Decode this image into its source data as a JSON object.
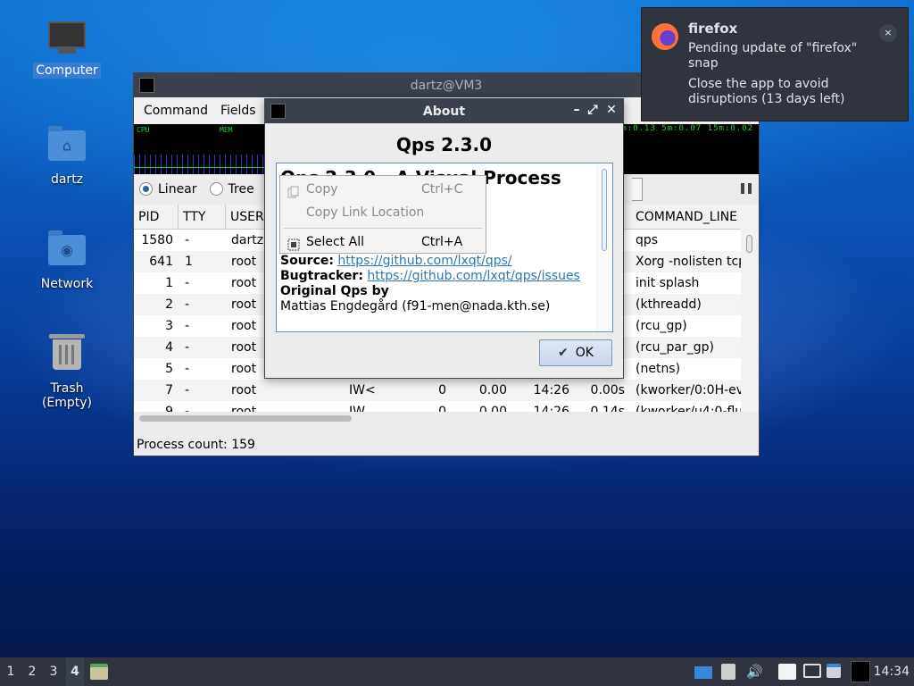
{
  "desktop": {
    "icons": [
      {
        "label": "Computer"
      },
      {
        "label": "dartz"
      },
      {
        "label": "Network"
      },
      {
        "label": "Trash (Empty)"
      }
    ]
  },
  "main_window": {
    "title": "dartz@VM3",
    "menu": [
      "Command",
      "Fields"
    ],
    "graph": {
      "cpu_label": "CPU",
      "mem_label": "MEM",
      "load_text": "1m:0.13 5m:0.07 15m:0.02"
    },
    "view_modes": {
      "linear": "Linear",
      "tree": "Tree",
      "selected": "Linear"
    },
    "columns": {
      "pid": "PID",
      "tty": "TTY",
      "user": "USER",
      "command_line": "COMMAND_LINE"
    },
    "rows": [
      {
        "pid": "1580",
        "tty": "-",
        "user": "dartz",
        "stat": "",
        "nice": "",
        "cpu": "",
        "start": "",
        "time": "",
        "cmd": "qps"
      },
      {
        "pid": "641",
        "tty": "1",
        "user": "root",
        "stat": "",
        "nice": "",
        "cpu": "",
        "start": "",
        "time": "",
        "cmd": "Xorg -nolisten tcp"
      },
      {
        "pid": "1",
        "tty": "-",
        "user": "root",
        "stat": "",
        "nice": "",
        "cpu": "",
        "start": "",
        "time": "",
        "cmd": "init splash"
      },
      {
        "pid": "2",
        "tty": "-",
        "user": "root",
        "stat": "",
        "nice": "",
        "cpu": "",
        "start": "",
        "time": "",
        "cmd": "(kthreadd)"
      },
      {
        "pid": "3",
        "tty": "-",
        "user": "root",
        "stat": "",
        "nice": "",
        "cpu": "",
        "start": "",
        "time": "",
        "cmd": "(rcu_gp)"
      },
      {
        "pid": "4",
        "tty": "-",
        "user": "root",
        "stat": "",
        "nice": "",
        "cpu": "",
        "start": "",
        "time": "",
        "cmd": "(rcu_par_gp)"
      },
      {
        "pid": "5",
        "tty": "-",
        "user": "root",
        "stat": "",
        "nice": "",
        "cpu": "",
        "start": "",
        "time": "",
        "cmd": "(netns)"
      },
      {
        "pid": "7",
        "tty": "-",
        "user": "root",
        "stat": "IW<",
        "nice": "0",
        "cpu": "0.00",
        "start": "14:26",
        "time": "0.00s",
        "cmd": "(kworker/0:0H-ev"
      },
      {
        "pid": "9",
        "tty": "-",
        "user": "root",
        "stat": "IW",
        "nice": "0",
        "cpu": "0.00",
        "start": "14:26",
        "time": "0.14s",
        "cmd": "(kworker/u4:0-flu"
      }
    ],
    "status": "Process count: 159"
  },
  "about_dialog": {
    "title": "About",
    "heading": "Qps 2.3.0",
    "body_heading": "Qps 2.3.0 - A Visual Process",
    "source_label": "Source:",
    "source_url": "https://github.com/lxqt/qps/",
    "bugtracker_label": "Bugtracker:",
    "bugtracker_url": "https://github.com/lxqt/qps/issues",
    "original_label": "Original Qps by",
    "original_author": "Mattias Engdegård (f91-men@nada.kth.se)",
    "ok_label": "OK"
  },
  "context_menu": {
    "items": [
      {
        "label": "Copy",
        "shortcut": "Ctrl+C",
        "enabled": false
      },
      {
        "label": "Copy Link Location",
        "shortcut": "",
        "enabled": false
      },
      {
        "label": "Select All",
        "shortcut": "Ctrl+A",
        "enabled": true
      }
    ]
  },
  "notification": {
    "app": "firefox",
    "line1": "Pending update of \"firefox\" snap",
    "line2": "Close the app to avoid disruptions (13 days left)",
    "close_glyph": "×"
  },
  "taskbar": {
    "workspaces": [
      "1",
      "2",
      "3",
      "4"
    ],
    "active_workspace": "4",
    "clock": "14:34"
  }
}
